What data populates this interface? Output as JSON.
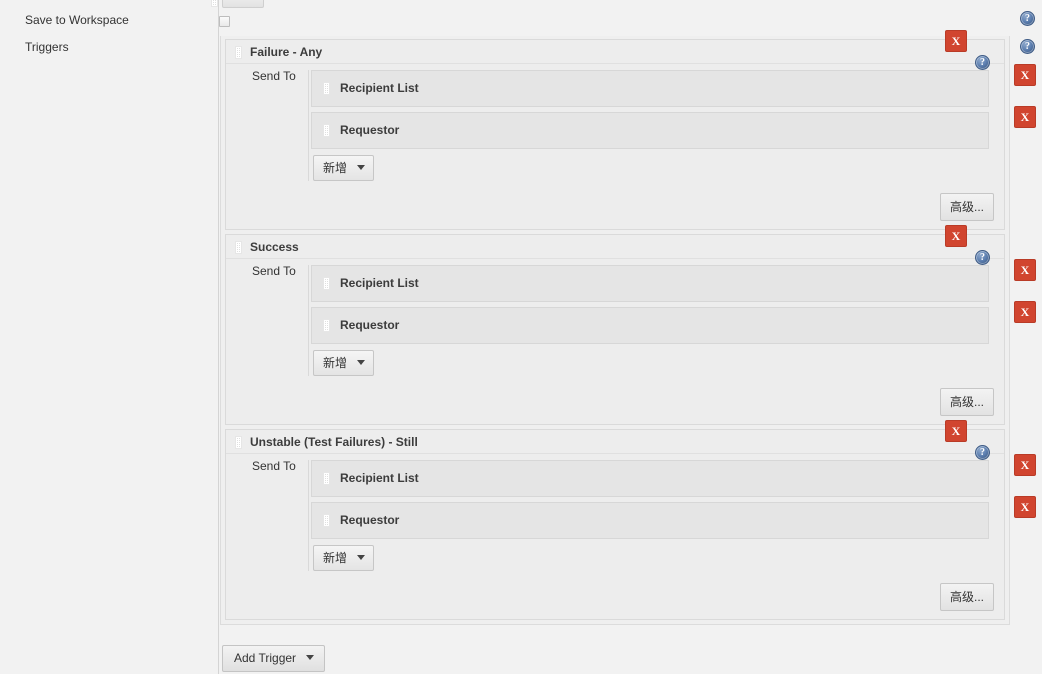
{
  "form": {
    "labels": {
      "save_to_workspace": "Save to Workspace",
      "triggers": "Triggers",
      "send_to": "Send To"
    }
  },
  "buttons": {
    "add_recipient": "新增",
    "advanced": "高级...",
    "add_trigger": "Add Trigger",
    "delete": "X"
  },
  "icons": {
    "help": "?"
  },
  "triggers": [
    {
      "title": "Failure - Any",
      "recipients": [
        {
          "label": "Recipient List"
        },
        {
          "label": "Requestor"
        }
      ]
    },
    {
      "title": "Success",
      "recipients": [
        {
          "label": "Recipient List"
        },
        {
          "label": "Requestor"
        }
      ]
    },
    {
      "title": "Unstable (Test Failures) - Still",
      "recipients": [
        {
          "label": "Recipient List"
        },
        {
          "label": "Requestor"
        }
      ]
    }
  ],
  "colors": {
    "delete_button": "#d1452f",
    "help_icon": "#5d7fb0",
    "page_background": "#f2f2f2",
    "panel_background": "#ededed"
  }
}
